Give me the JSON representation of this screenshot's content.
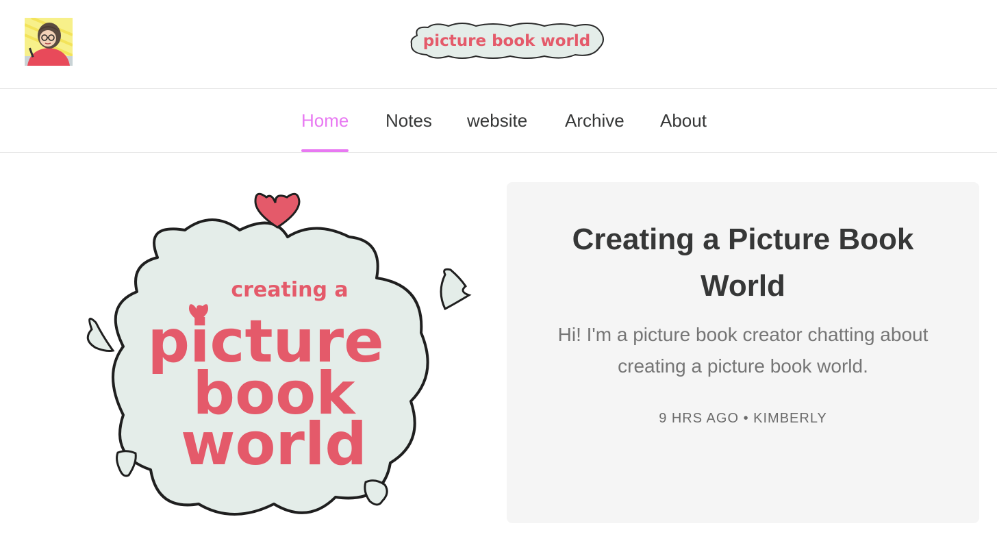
{
  "header": {
    "avatar_icon": "author-avatar-illustration",
    "logo_text": "picture book world"
  },
  "nav": {
    "active_color": "#e879f2",
    "items": [
      {
        "label": "Home",
        "active": true
      },
      {
        "label": "Notes",
        "active": false
      },
      {
        "label": "website",
        "active": false
      },
      {
        "label": "Archive",
        "active": false
      },
      {
        "label": "About",
        "active": false
      }
    ]
  },
  "hero": {
    "artwork": {
      "line1": "creating a",
      "line2": "picture",
      "line3": "book",
      "line4": "world",
      "brand_color": "#e45a6a",
      "cloud_color": "#e4ede9"
    },
    "title": "Creating a Picture Book World",
    "subtitle": "Hi! I'm a picture book creator chatting about creating a picture book world.",
    "meta": {
      "time": "9 HRS AGO",
      "separator": "•",
      "author": "KIMBERLY"
    }
  }
}
